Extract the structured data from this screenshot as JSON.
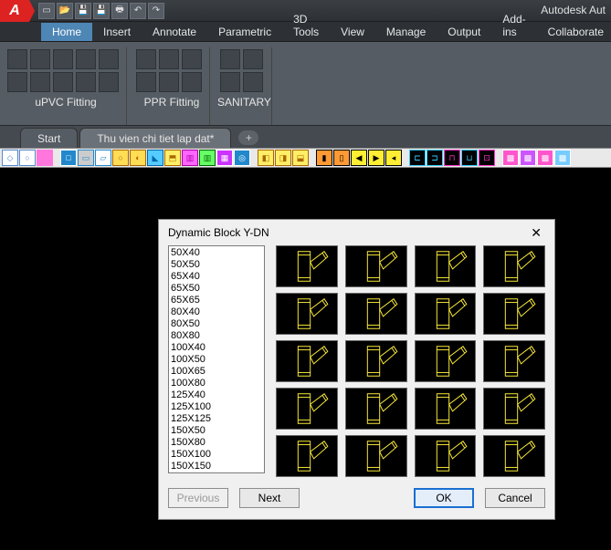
{
  "title": "Autodesk Aut",
  "app_letter": "A",
  "qat": [
    "new",
    "open",
    "save",
    "saveas",
    "plot",
    "undo",
    "redo"
  ],
  "ribbon": {
    "tabs": [
      "Home",
      "Insert",
      "Annotate",
      "Parametric",
      "3D Tools",
      "View",
      "Manage",
      "Output",
      "Add-ins",
      "Collaborate"
    ],
    "active_tab": "Home",
    "groups": [
      {
        "label": "uPVC Fitting",
        "cols": 5,
        "cells": 10
      },
      {
        "label": "PPR Fitting",
        "cols": 3,
        "cells": 6
      },
      {
        "label": "SANITARY",
        "cols": 2,
        "cells": 4
      }
    ]
  },
  "doc_tabs": {
    "items": [
      "Start",
      "Thu vien chi tiet lap dat*"
    ],
    "active": 1,
    "add": "+"
  },
  "toolstrip_groups": [
    [
      {
        "bg": "#fff",
        "fg": "#58c",
        "ch": "◇"
      },
      {
        "bg": "#fff",
        "fg": "#58c",
        "ch": "○"
      },
      {
        "bg": "#f7d",
        "fg": "#f7d",
        "ch": "logo"
      }
    ],
    [
      {
        "bg": "#28c",
        "fg": "#fff",
        "ch": "□"
      },
      {
        "bg": "#ccc",
        "fg": "#28c",
        "ch": "▭"
      },
      {
        "bg": "#fff",
        "fg": "#28c",
        "ch": "▱"
      },
      {
        "bg": "#fd5",
        "fg": "#a60",
        "ch": "○"
      },
      {
        "bg": "#fd5",
        "fg": "#a60",
        "ch": "◐"
      },
      {
        "bg": "#5cf",
        "fg": "#06a",
        "ch": "◣"
      },
      {
        "bg": "#fe6",
        "fg": "#a60",
        "ch": "⬒"
      },
      {
        "bg": "#f6f",
        "fg": "#a0a",
        "ch": "▥"
      },
      {
        "bg": "#6f6",
        "fg": "#060",
        "ch": "▥"
      },
      {
        "bg": "#c3f",
        "fg": "#fff",
        "ch": "▦"
      },
      {
        "bg": "#28c",
        "fg": "#fff",
        "ch": "◎"
      }
    ],
    [
      {
        "bg": "#fe6",
        "fg": "#a60",
        "ch": "◧"
      },
      {
        "bg": "#fe6",
        "fg": "#a60",
        "ch": "◨"
      },
      {
        "bg": "#fe6",
        "fg": "#a60",
        "ch": "⬓"
      }
    ],
    [
      {
        "bg": "#f93",
        "fg": "#000",
        "ch": "▮"
      },
      {
        "bg": "#f93",
        "fg": "#000",
        "ch": "▯"
      },
      {
        "bg": "#fe3",
        "fg": "#000",
        "ch": "◀"
      },
      {
        "bg": "#fe3",
        "fg": "#000",
        "ch": "▶"
      },
      {
        "bg": "#fe3",
        "fg": "#000",
        "ch": "◂"
      }
    ],
    [
      {
        "bg": "#000",
        "fg": "#3cf",
        "ch": "⊏"
      },
      {
        "bg": "#000",
        "fg": "#3cf",
        "ch": "⊐"
      },
      {
        "bg": "#000",
        "fg": "#f3c",
        "ch": "⊓"
      },
      {
        "bg": "#000",
        "fg": "#3cf",
        "ch": "⊔"
      },
      {
        "bg": "#000",
        "fg": "#f3c",
        "ch": "⊡"
      }
    ],
    [
      {
        "bg": "#f5c",
        "fg": "#fff",
        "ch": "▩"
      },
      {
        "bg": "#c5f",
        "fg": "#fff",
        "ch": "▩"
      },
      {
        "bg": "#f5c",
        "fg": "#fff",
        "ch": "▩"
      },
      {
        "bg": "#7cf",
        "fg": "#fff",
        "ch": "▩"
      }
    ]
  ],
  "dialog": {
    "title": "Dynamic Block Y-DN",
    "close": "✕",
    "list": [
      "50X40",
      "50X50",
      "65X40",
      "65X50",
      "65X65",
      "80X40",
      "80X50",
      "80X80",
      "100X40",
      "100X50",
      "100X65",
      "100X80",
      "125X40",
      "125X100",
      "125X125",
      "150X50",
      "150X80",
      "150X100",
      "150X150"
    ],
    "thumb_count": 20,
    "buttons": {
      "prev": "Previous",
      "next": "Next",
      "ok": "OK",
      "cancel": "Cancel"
    }
  }
}
